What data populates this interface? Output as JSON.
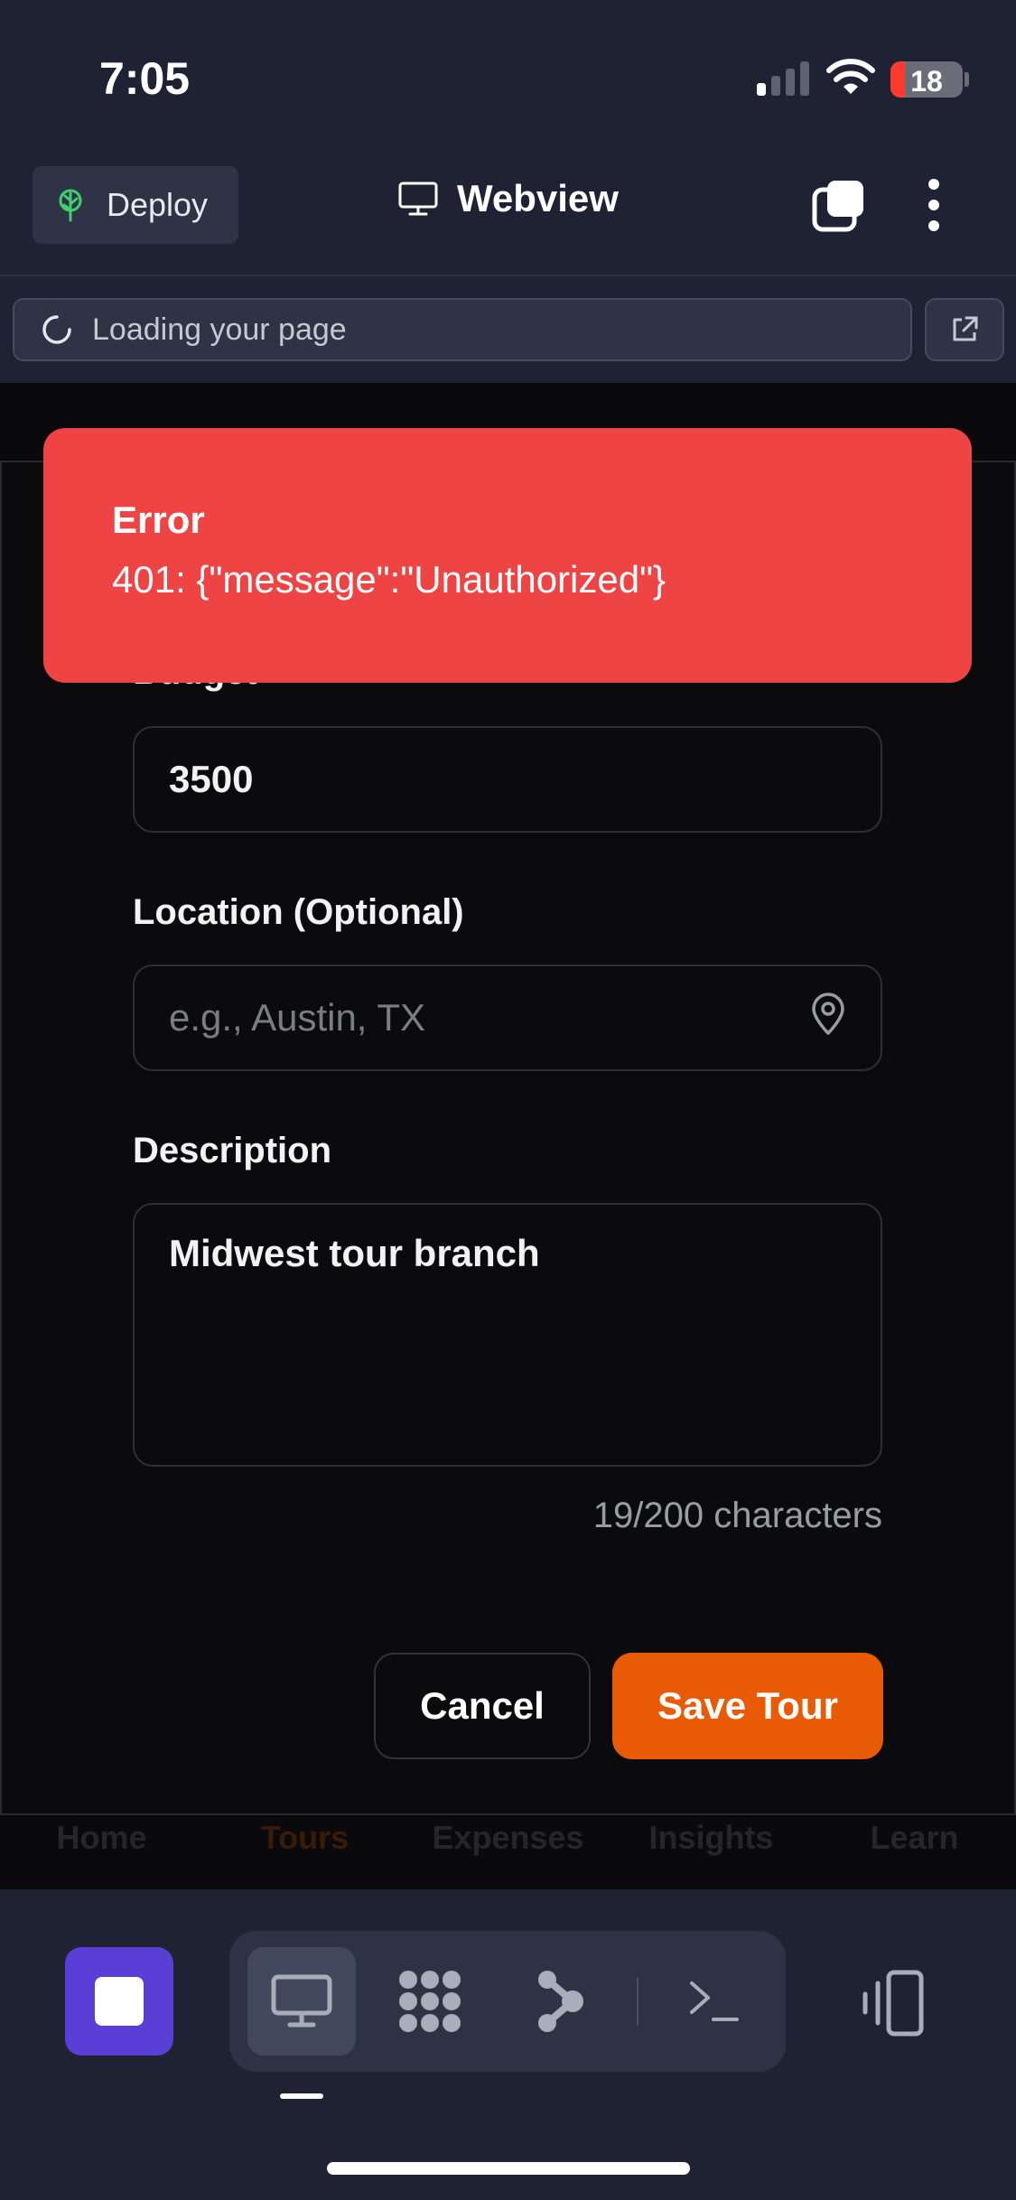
{
  "status_bar": {
    "time": "7:05",
    "battery_level": "18",
    "colors": {
      "battery_low": "#ff3b30"
    }
  },
  "header": {
    "deploy_label": "Deploy",
    "deploy_icon": "tree-icon",
    "title": "Webview",
    "title_icon": "monitor-icon"
  },
  "url_bar": {
    "text": "Loading your page"
  },
  "form": {
    "budget_label": "Budget",
    "budget_value": "3500",
    "location_label": "Location (Optional)",
    "location_placeholder": "e.g., Austin, TX",
    "description_label": "Description",
    "description_value": "Midwest tour branch",
    "char_count": "19/200 characters",
    "cancel_label": "Cancel",
    "save_label": "Save Tour"
  },
  "bottom_nav": {
    "items": [
      {
        "label": "Home"
      },
      {
        "label": "Tours"
      },
      {
        "label": "Expenses"
      },
      {
        "label": "Insights"
      },
      {
        "label": "Learn"
      }
    ],
    "active": "Tours"
  },
  "toast": {
    "title": "Error",
    "message": "401: {\"message\":\"Unauthorized\"}"
  },
  "colors": {
    "accent": "#e85a04",
    "error": "#ef4444",
    "stop_button": "#5a3fd6"
  }
}
